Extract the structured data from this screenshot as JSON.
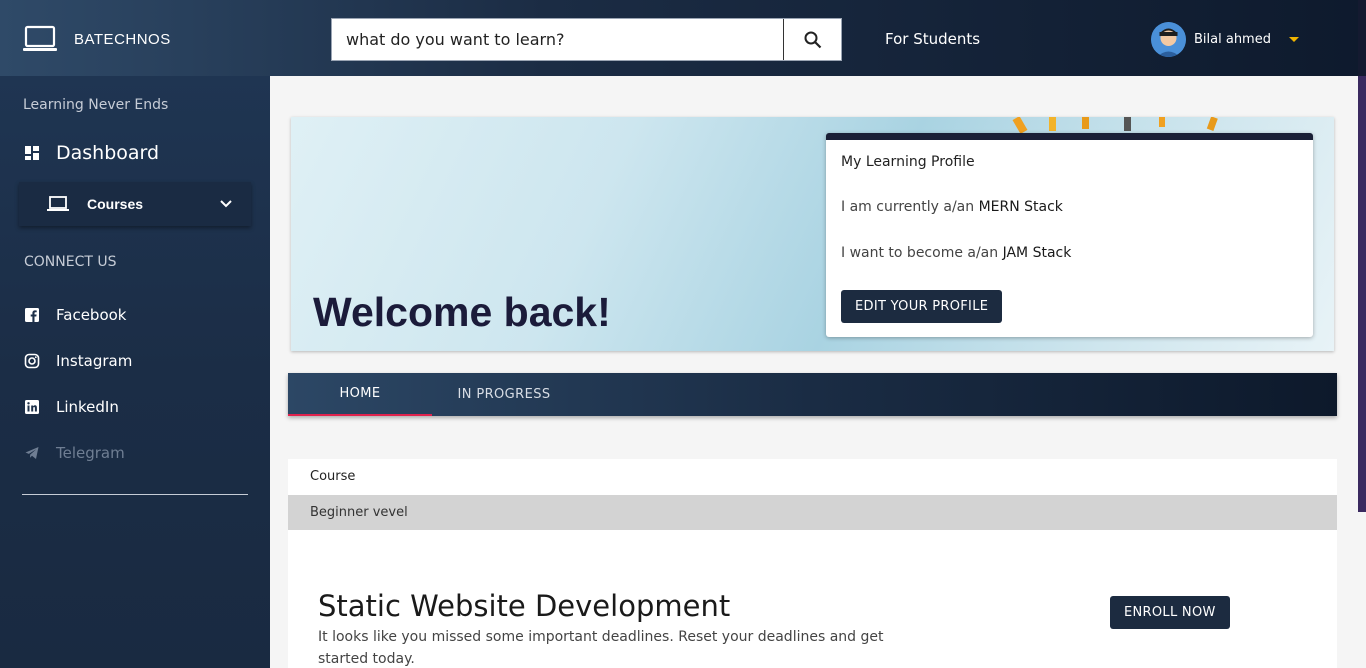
{
  "header": {
    "brand": "BATECHNOS",
    "search_placeholder": "what do you want to learn?",
    "for_students": "For Students",
    "user_name": "Bilal ahmed"
  },
  "sidebar": {
    "tagline": "Learning Never Ends",
    "dashboard": "Dashboard",
    "courses": "Courses",
    "connect_title": "CONNECT US",
    "social": [
      "Facebook",
      "Instagram",
      "LinkedIn",
      "Telegram"
    ]
  },
  "banner": {
    "welcome": "Welcome back!",
    "profile": {
      "title": "My Learning Profile",
      "current_prefix": "I am currently a/an",
      "current_value": "MERN Stack",
      "goal_prefix": "I want to become a/an",
      "goal_value": "JAM Stack",
      "edit_button": "EDIT YOUR PROFILE"
    }
  },
  "tabs": [
    "HOME",
    "IN PROGRESS"
  ],
  "course": {
    "header": "Course",
    "level": "Beginner vevel",
    "title": "Static Website Development",
    "description": "It looks like you missed some important deadlines. Reset your deadlines and get started today.",
    "enroll_button": "ENROLL NOW"
  },
  "colors": {
    "accent_tab_underline": "#e0234e",
    "button_bg": "#1c2b40",
    "caret": "#f0b400"
  }
}
